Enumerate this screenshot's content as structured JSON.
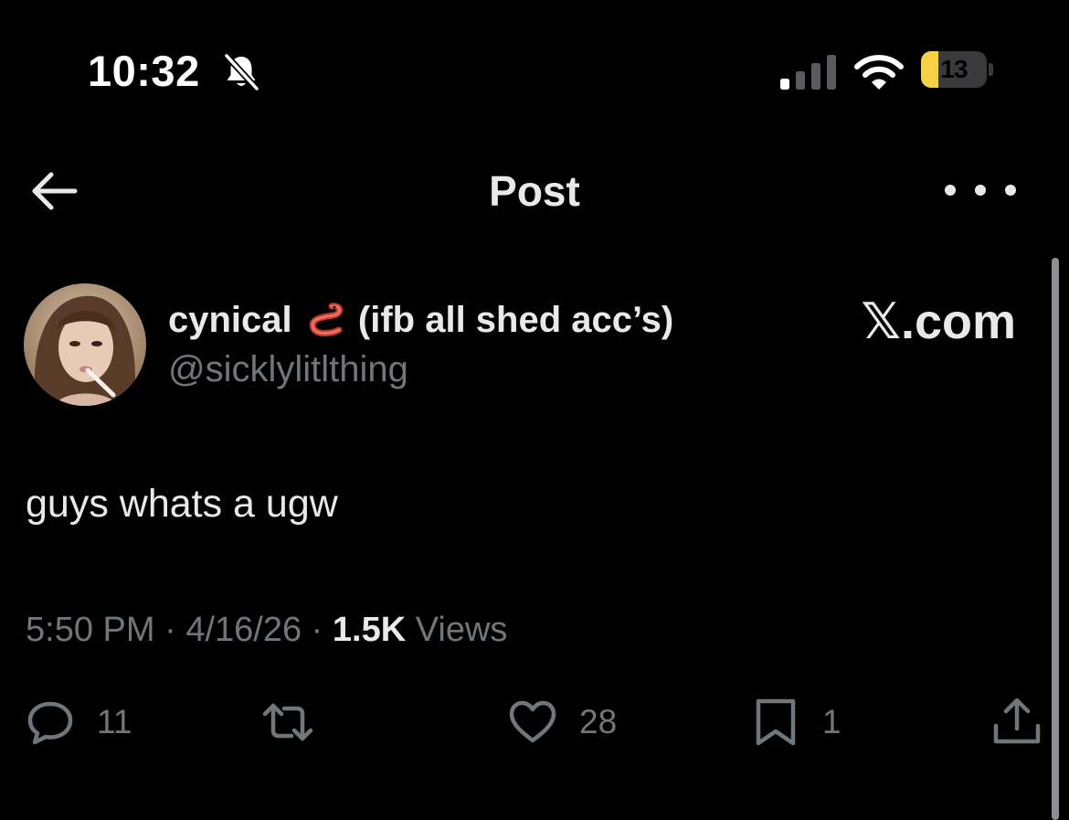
{
  "status_bar": {
    "time": "10:32",
    "battery_level": "13",
    "battery_fraction": 0.13,
    "icons": [
      "bell-slash-icon",
      "cellular-signal-icon",
      "wifi-icon",
      "battery-charging-icon"
    ]
  },
  "header": {
    "title": "Post",
    "back_icon": "arrow-left-icon",
    "more_icon": "ellipsis-icon"
  },
  "post": {
    "author": {
      "name_part1": "cynical",
      "name_part2": "(ifb all shed acc’s)",
      "name_emoji": "snake-emoji",
      "handle": "@sicklylitlthing"
    },
    "watermark": "𝕏.com",
    "text": "guys whats a ugw",
    "meta": {
      "time": "5:50 PM",
      "separator": "·",
      "date": "4/16/26",
      "views_count": "1.5K",
      "views_label": "Views"
    },
    "actions": {
      "replies": "11",
      "likes": "28",
      "bookmarks": "1"
    }
  },
  "colors": {
    "background": "#000000",
    "primary_text": "#e7e9ea",
    "secondary_text": "#71767b",
    "battery_accent": "#f5d147"
  }
}
